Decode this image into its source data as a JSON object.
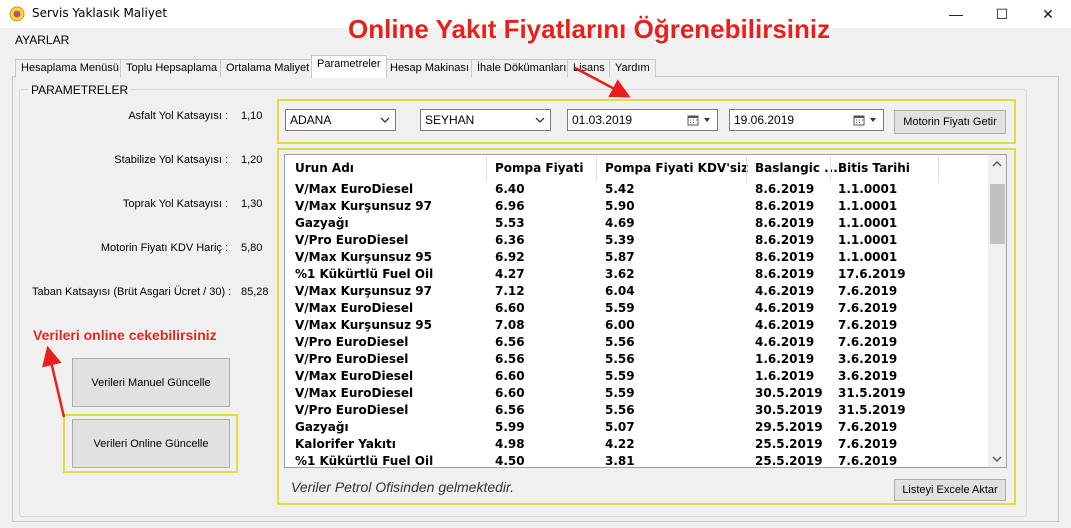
{
  "window": {
    "title": "Servis Yaklasık Maliyet",
    "minimize_glyph": "—",
    "maximize_glyph": "☐",
    "close_glyph": "✕",
    "icon": "app-icon"
  },
  "menu": {
    "settings": "AYARLAR"
  },
  "tabs": [
    {
      "label": "Hesaplama Menüsü"
    },
    {
      "label": "Toplu Hepsaplama"
    },
    {
      "label": "Ortalama Maliyet"
    },
    {
      "label": "Parametreler",
      "active": true
    },
    {
      "label": "Hesap Makinası"
    },
    {
      "label": "İhale Dökümanları"
    },
    {
      "label": "Lisans"
    },
    {
      "label": "Yardım"
    }
  ],
  "group_title": "PARAMETRELER",
  "params": [
    {
      "label": "Asfalt Yol Katsayısı :",
      "value": "1,10"
    },
    {
      "label": "Stabilize Yol Katsayısı :",
      "value": "1,20"
    },
    {
      "label": "Toprak Yol Katsayısı :",
      "value": "1,30"
    },
    {
      "label": "Motorin Fiyatı KDV Hariç :",
      "value": "5,80"
    },
    {
      "label": "Taban Katsayısı (Brüt Asgari Ücret / 30) :",
      "value": "85,28"
    }
  ],
  "buttons": {
    "manual_update": "Verileri Manuel Güncelle",
    "online_update": "Verileri Online Güncelle",
    "get_fuel_price": "Motorin Fiyatı Getir",
    "export_excel": "Listeyi Excele Aktar"
  },
  "filters": {
    "city": "ADANA",
    "district": "SEYHAN",
    "start_date": "01.03.2019",
    "end_date": "19.06.2019"
  },
  "grid": {
    "columns": [
      "Urun Adı",
      "Pompa Fiyati",
      "Pompa Fiyati KDV'siz",
      "Baslangic ...",
      "Bitis Tarihi"
    ],
    "rows": [
      [
        "V/Max EuroDiesel",
        "6.40",
        "5.42",
        "8.6.2019",
        "1.1.0001"
      ],
      [
        "V/Max Kurşunsuz 97",
        "6.96",
        "5.90",
        "8.6.2019",
        "1.1.0001"
      ],
      [
        "Gazyağı",
        "5.53",
        "4.69",
        "8.6.2019",
        "1.1.0001"
      ],
      [
        "V/Pro EuroDiesel",
        "6.36",
        "5.39",
        "8.6.2019",
        "1.1.0001"
      ],
      [
        "V/Max Kurşunsuz 95",
        "6.92",
        "5.87",
        "8.6.2019",
        "1.1.0001"
      ],
      [
        "%1 Kükürtlü Fuel Oil",
        "4.27",
        "3.62",
        "8.6.2019",
        "17.6.2019"
      ],
      [
        "V/Max Kurşunsuz 97",
        "7.12",
        "6.04",
        "4.6.2019",
        "7.6.2019"
      ],
      [
        "V/Max EuroDiesel",
        "6.60",
        "5.59",
        "4.6.2019",
        "7.6.2019"
      ],
      [
        "V/Max Kurşunsuz 95",
        "7.08",
        "6.00",
        "4.6.2019",
        "7.6.2019"
      ],
      [
        "V/Pro EuroDiesel",
        "6.56",
        "5.56",
        "4.6.2019",
        "7.6.2019"
      ],
      [
        "V/Pro EuroDiesel",
        "6.56",
        "5.56",
        "1.6.2019",
        "3.6.2019"
      ],
      [
        "V/Max EuroDiesel",
        "6.60",
        "5.59",
        "1.6.2019",
        "3.6.2019"
      ],
      [
        "V/Max EuroDiesel",
        "6.60",
        "5.59",
        "30.5.2019",
        "31.5.2019"
      ],
      [
        "V/Pro EuroDiesel",
        "6.56",
        "5.56",
        "30.5.2019",
        "31.5.2019"
      ],
      [
        "Gazyağı",
        "5.99",
        "5.07",
        "29.5.2019",
        "7.6.2019"
      ],
      [
        "Kalorifer Yakıtı",
        "4.98",
        "4.22",
        "25.5.2019",
        "7.6.2019"
      ],
      [
        "%1 Kükürtlü Fuel Oil",
        "4.50",
        "3.81",
        "25.5.2019",
        "7.6.2019"
      ]
    ]
  },
  "footer_note": "Veriler Petrol Ofisinden gelmektedir.",
  "annotations": {
    "top": "Online Yakıt Fiyatlarını  Öğrenebilirsiniz",
    "left": "Verileri online cekebilirsiniz"
  },
  "colors": {
    "annotation": "#e8201c",
    "highlight_box": "#e3dc3a",
    "window_bg": "#f0f0f0"
  }
}
